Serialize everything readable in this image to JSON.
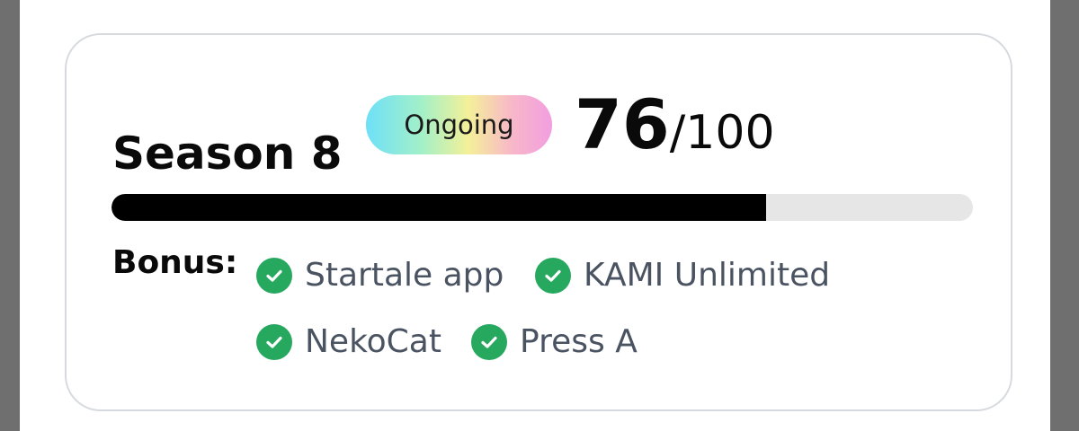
{
  "season": {
    "title": "Season 8",
    "status": "Ongoing",
    "score": "76",
    "score_total": "/100",
    "progress": 0.76
  },
  "bonus": {
    "label": "Bonus:",
    "items": [
      {
        "label": "Startale app",
        "icon": "check-circle-icon",
        "checked": true
      },
      {
        "label": "KAMI Unlimited",
        "icon": "check-circle-icon",
        "checked": true
      },
      {
        "label": "NekoCat",
        "icon": "check-circle-icon",
        "checked": true
      },
      {
        "label": "Press A",
        "icon": "check-circle-icon",
        "checked": true
      }
    ]
  },
  "colors": {
    "check": "#27a85f",
    "progress_fill": "#000000",
    "progress_track": "#e6e6e6",
    "bonus_text": "#4a5361"
  }
}
